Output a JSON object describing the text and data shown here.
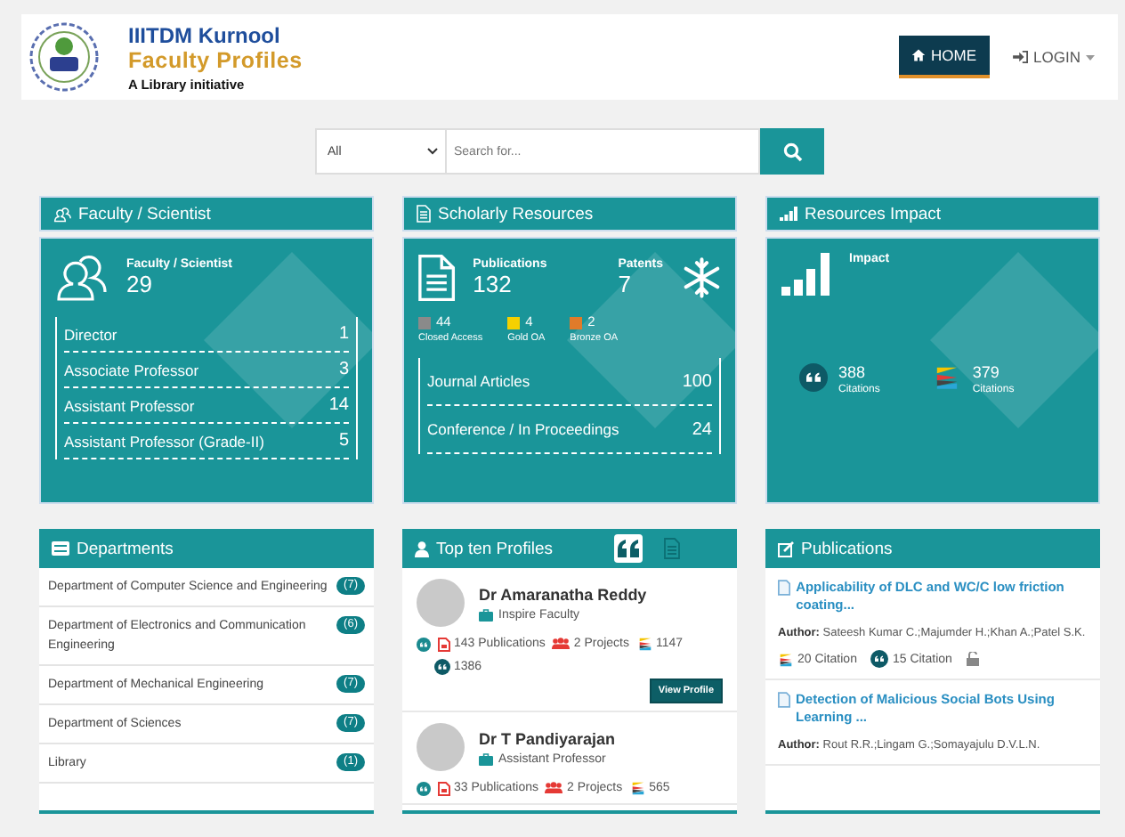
{
  "header": {
    "title": "IIITDM Kurnool",
    "subtitle": "Faculty Profiles",
    "tagline": "A Library initiative",
    "nav": [
      {
        "kind": "home",
        "label": "HOME",
        "selected": true
      },
      {
        "kind": "login",
        "label": "LOGIN",
        "selected": false
      }
    ]
  },
  "search": {
    "scope": "All",
    "placeholder": "Search for..."
  },
  "faculty": {
    "header": "Faculty / Scientist",
    "stat_label": "Faculty / Scientist",
    "stat_value": "29",
    "roles": [
      {
        "name": "Director",
        "count": "1"
      },
      {
        "name": "Associate Professor",
        "count": "3"
      },
      {
        "name": "Assistant Professor",
        "count": "14"
      },
      {
        "name": "Assistant Professor (Grade-II)",
        "count": "5"
      }
    ]
  },
  "scholarly": {
    "header": "Scholarly Resources",
    "publications": {
      "label": "Publications",
      "value": "132"
    },
    "patents": {
      "label": "Patents",
      "value": "7"
    },
    "access": [
      {
        "count": "44",
        "label": "Closed Access",
        "color": "#8a8a8a"
      },
      {
        "count": "4",
        "label": "Gold OA",
        "color": "#f5d000"
      },
      {
        "count": "2",
        "label": "Bronze OA",
        "color": "#e07b2a"
      }
    ],
    "types": [
      {
        "name": "Journal Articles",
        "count": "100"
      },
      {
        "name": "Conference / In Proceedings",
        "count": "24"
      }
    ]
  },
  "impact": {
    "header": "Resources Impact",
    "label": "Impact",
    "metrics": [
      {
        "kind": "quote",
        "value": "388",
        "label": "Citations"
      },
      {
        "kind": "stack",
        "value": "379",
        "label": "Citations"
      }
    ]
  },
  "departments": {
    "header": "Departments",
    "items": [
      {
        "name": "Department of Computer Science and Engineering",
        "count": "(7)"
      },
      {
        "name": "Department of Electronics and Communication Engineering",
        "count": "(6)"
      },
      {
        "name": "Department of Mechanical Engineering",
        "count": "(7)"
      },
      {
        "name": "Department of Sciences",
        "count": "(7)"
      },
      {
        "name": "Library",
        "count": "(1)"
      }
    ]
  },
  "top_profiles": {
    "header": "Top ten Profiles",
    "toggles": [
      {
        "kind": "quote",
        "selected": true
      },
      {
        "kind": "doc",
        "selected": false
      }
    ],
    "profiles": [
      {
        "name": "Dr Amaranatha Reddy",
        "designation": "Inspire Faculty",
        "publications": "143 Publications",
        "projects": "2 Projects",
        "citations_a": "1147",
        "citations_b": "1386",
        "button": "View Profile"
      },
      {
        "name": "Dr T Pandiyarajan",
        "designation": "Assistant Professor",
        "publications": "33 Publications",
        "projects": "2 Projects",
        "citations_a": "565"
      }
    ]
  },
  "publications": {
    "header": "Publications",
    "items": [
      {
        "title": "Applicability of DLC and WC/C low friction coating...",
        "author_label": "Author:",
        "authors": "Sateesh Kumar C.;Majumder H.;Khan A.;Patel S.K.",
        "citations_a": "20 Citation",
        "citations_b": "15 Citation"
      },
      {
        "title": "Detection of Malicious Social Bots Using Learning ...",
        "author_label": "Author:",
        "authors": "Rout R.R.;Lingam G.;Somayajulu D.V.L.N."
      }
    ]
  }
}
